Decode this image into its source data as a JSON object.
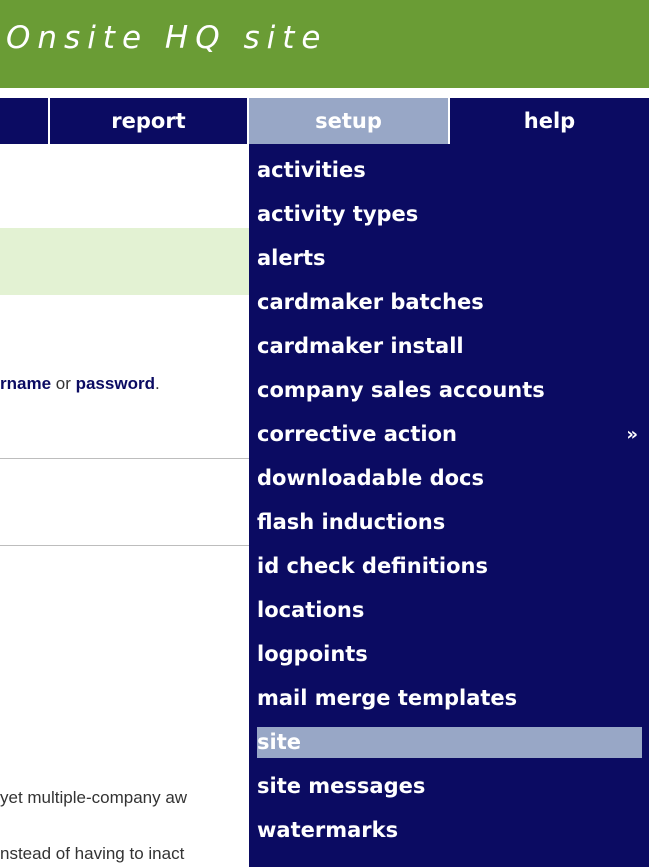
{
  "banner": {
    "title": "Onsite HQ site"
  },
  "nav": {
    "items": [
      {
        "label": ""
      },
      {
        "label": "report"
      },
      {
        "label": "setup"
      },
      {
        "label": "help"
      }
    ]
  },
  "content": {
    "line1_prefix": "rname",
    "line1_mid": " or ",
    "line1_bold": "password",
    "line1_suffix": ".",
    "line2": "yet multiple-company aw",
    "line3": "nstead of having to inact"
  },
  "setup_menu": {
    "items": [
      {
        "label": "activities"
      },
      {
        "label": "activity types"
      },
      {
        "label": "alerts"
      },
      {
        "label": "cardmaker batches"
      },
      {
        "label": "cardmaker install"
      },
      {
        "label": "company sales accounts"
      },
      {
        "label": "corrective action",
        "submenu_glyph": "»"
      },
      {
        "label": "downloadable docs"
      },
      {
        "label": "flash inductions"
      },
      {
        "label": "id check definitions"
      },
      {
        "label": "locations"
      },
      {
        "label": "logpoints"
      },
      {
        "label": "mail merge templates"
      },
      {
        "label": "site"
      },
      {
        "label": "site messages"
      },
      {
        "label": "watermarks"
      }
    ],
    "selected": "site"
  },
  "colors": {
    "banner": "#6a9c35",
    "navbar": "#0b0b62",
    "active": "#98a7c6",
    "highlight_row": "#e3f2d3"
  }
}
